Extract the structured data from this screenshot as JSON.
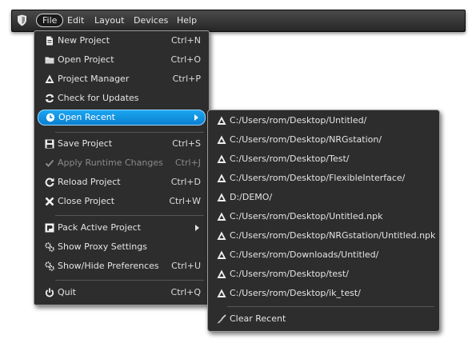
{
  "menubar": {
    "items": [
      {
        "label": "File"
      },
      {
        "label": "Edit"
      },
      {
        "label": "Layout"
      },
      {
        "label": "Devices"
      },
      {
        "label": "Help"
      }
    ]
  },
  "file_menu": {
    "items": [
      {
        "label": "New Project",
        "shortcut": "Ctrl+N",
        "icon": "new-file-icon"
      },
      {
        "label": "Open Project",
        "shortcut": "Ctrl+O",
        "icon": "folder-icon"
      },
      {
        "label": "Project Manager",
        "shortcut": "Ctrl+P",
        "icon": "project-manager-icon"
      },
      {
        "label": "Check for Updates",
        "shortcut": "",
        "icon": "refresh-icon"
      },
      {
        "label": "Open Recent",
        "shortcut": "",
        "icon": "clock-icon"
      },
      {
        "label": "Save Project",
        "shortcut": "Ctrl+S",
        "icon": "save-icon"
      },
      {
        "label": "Apply Runtime Changes",
        "shortcut": "Ctrl+J",
        "icon": "check-icon",
        "disabled": true
      },
      {
        "label": "Reload Project",
        "shortcut": "Ctrl+D",
        "icon": "reload-icon"
      },
      {
        "label": "Close Project",
        "shortcut": "Ctrl+W",
        "icon": "close-icon"
      },
      {
        "label": "Pack Active Project",
        "shortcut": "",
        "icon": "pack-icon"
      },
      {
        "label": "Show Proxy Settings",
        "shortcut": "",
        "icon": "gears-icon"
      },
      {
        "label": "Show/Hide Preferences",
        "shortcut": "Ctrl+U",
        "icon": "gears-icon"
      },
      {
        "label": "Quit",
        "shortcut": "Ctrl+Q",
        "icon": "power-icon"
      }
    ]
  },
  "recent_menu": {
    "items": [
      {
        "label": "C:/Users/rom/Desktop/Untitled/"
      },
      {
        "label": "C:/Users/rom/Desktop/NRGstation/"
      },
      {
        "label": "C:/Users/rom/Desktop/Test/"
      },
      {
        "label": "C:/Users/rom/Desktop/FlexibleInterface/"
      },
      {
        "label": "D:/DEMO/"
      },
      {
        "label": "C:/Users/rom/Desktop/Untitled.npk"
      },
      {
        "label": "C:/Users/rom/Desktop/NRGstation/Untitled.npk"
      },
      {
        "label": "C:/Users/rom/Downloads/Untitled/"
      },
      {
        "label": "C:/Users/rom/Desktop/test/"
      },
      {
        "label": "C:/Users/rom/Desktop/ik_test/"
      }
    ],
    "clear_label": "Clear Recent"
  },
  "colors": {
    "menu_bg": "#2d2d2d",
    "highlight": "#1aa6f0",
    "text": "#e4e4e4",
    "disabled_text": "#8a8a8a"
  }
}
